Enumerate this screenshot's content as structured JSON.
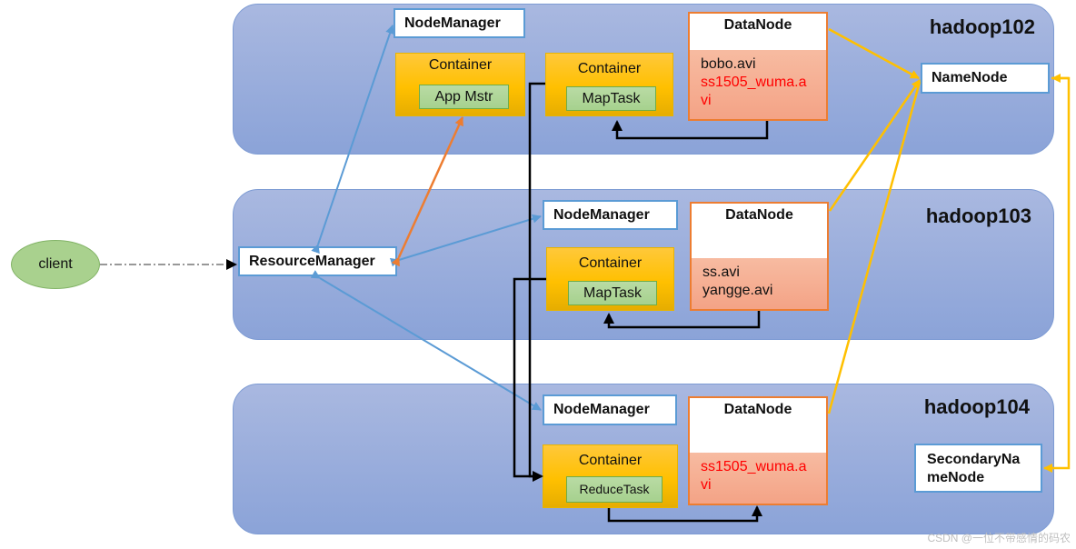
{
  "client": {
    "label": "client"
  },
  "resource_manager": {
    "label": "ResourceManager"
  },
  "hosts": [
    {
      "name": "hadoop102",
      "node_manager": "NodeManager",
      "containers": [
        {
          "title": "Container",
          "task": "App Mstr"
        },
        {
          "title": "Container",
          "task": "MapTask"
        }
      ],
      "datanode": {
        "title": "DataNode",
        "files": [
          {
            "text": "bobo.avi",
            "highlight": false
          },
          {
            "text": "ss1505_wuma.a",
            "highlight": true
          },
          {
            "text": "vi",
            "highlight": true
          }
        ]
      },
      "extra": "NameNode"
    },
    {
      "name": "hadoop103",
      "node_manager": "NodeManager",
      "containers": [
        {
          "title": "Container",
          "task": "MapTask"
        }
      ],
      "datanode": {
        "title": "DataNode",
        "files": [
          {
            "text": "ss.avi",
            "highlight": false
          },
          {
            "text": "yangge.avi",
            "highlight": false
          }
        ]
      }
    },
    {
      "name": "hadoop104",
      "node_manager": "NodeManager",
      "containers": [
        {
          "title": "Container",
          "task": "ReduceTask"
        }
      ],
      "datanode": {
        "title": "DataNode",
        "files": [
          {
            "text": "ss1505_wuma.a",
            "highlight": true
          },
          {
            "text": "vi",
            "highlight": true
          }
        ]
      },
      "extra": "SecondaryNameNode",
      "extra_lines": [
        "SecondaryNa",
        "meNode"
      ]
    }
  ],
  "colors": {
    "yarn_link": "#5b9bd5",
    "am_link": "#ed7d31",
    "hdfs_link": "#ffc000",
    "data_flow": "#000000",
    "file_highlight": "#ff0000"
  },
  "watermark": "CSDN @一位不带感情的码农"
}
